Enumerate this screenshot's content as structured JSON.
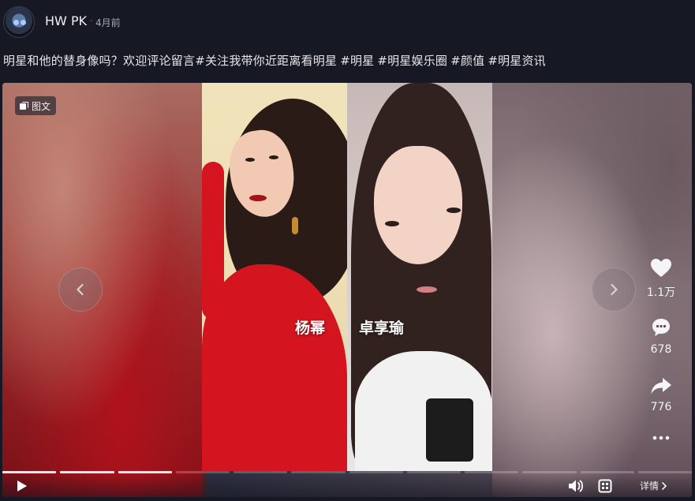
{
  "header": {
    "username": "HW PK",
    "dot": "·",
    "time": "4月前"
  },
  "caption": {
    "text": "明星和他的替身像吗？欢迎评论留言",
    "tags": [
      "#关注我带你近距离看明星",
      "#明星",
      "#明星娱乐圈",
      "#颜值",
      "#明星资讯"
    ]
  },
  "media": {
    "type_badge": "图文",
    "left_name": "杨幂",
    "right_name": "卓享瑜",
    "progress": {
      "total_segments": 12,
      "current_segment": 3
    }
  },
  "actions": {
    "like_count": "1.1万",
    "comment_count": "678",
    "share_count": "776"
  },
  "controls": {
    "detail_label": "详情"
  },
  "colors": {
    "background": "#161823",
    "dress_red": "#d4151f"
  }
}
